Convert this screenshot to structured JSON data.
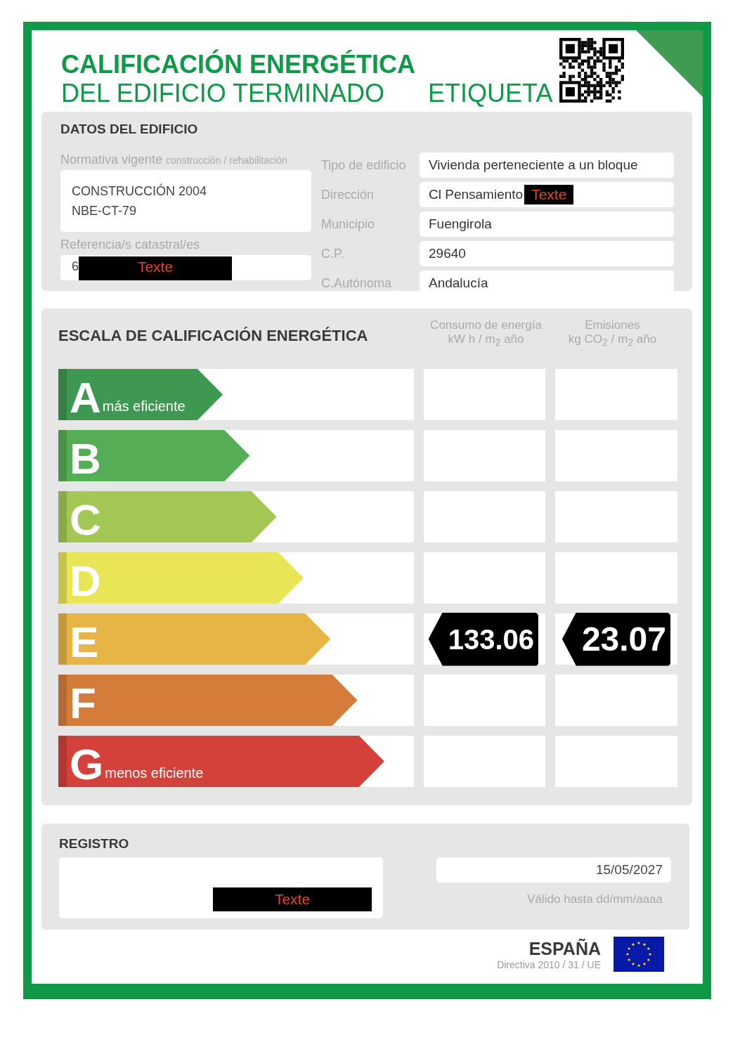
{
  "header": {
    "title_line1": "CALIFICACIÓN ENERGÉTICA",
    "title_line2": "DEL EDIFICIO TERMINADO",
    "label": "ETIQUETA"
  },
  "building": {
    "heading": "DATOS DEL EDIFICIO",
    "norm_label": "Normativa vigente",
    "norm_sublabel": "construcción / rehabilitación",
    "norm_lines": [
      "CONSTRUCCIÓN 2004",
      "NBE-CT-79"
    ],
    "ref_label": "Referencia/s catastral/es",
    "ref_value": "6",
    "ref_redaction": "Texte",
    "fields": [
      {
        "label": "Tipo de edificio",
        "value": "Vivienda perteneciente a un bloque"
      },
      {
        "label": "Dirección",
        "value": "Cl Pensamiento",
        "redaction": "Texte"
      },
      {
        "label": "Municipio",
        "value": "Fuengirola"
      },
      {
        "label": "C.P.",
        "value": "29640"
      },
      {
        "label": "C.Autónoma",
        "value": "Andalucía"
      }
    ]
  },
  "scale": {
    "heading": "ESCALA DE CALIFICACIÓN ENERGÉTICA",
    "energy_title": "Consumo de energía",
    "energy_unit": "kW h / m$_{2}$ año",
    "emissions_title": "Emisiones",
    "emissions_unit": "kg CO$_{2}$ / m$_{2}$ año",
    "classes": [
      {
        "letter": "A",
        "caption": "más eficiente",
        "color": "#3e9851"
      },
      {
        "letter": "B",
        "color": "#55ad55"
      },
      {
        "letter": "C",
        "color": "#a3c754"
      },
      {
        "letter": "D",
        "color": "#e8e556"
      },
      {
        "letter": "E",
        "color": "#e7b446",
        "energy": "133.06",
        "emissions": "23.07"
      },
      {
        "letter": "F",
        "color": "#d67c3b"
      },
      {
        "letter": "G",
        "caption": "menos eficiente",
        "color": "#d4403a"
      }
    ]
  },
  "registry": {
    "heading": "REGISTRO",
    "redaction": "Texte",
    "date": "15/05/2027",
    "date_hint": "Válido hasta dd/mm/aaaa"
  },
  "footer": {
    "country": "ESPAÑA",
    "directive": "Directiva 2010 / 31 / UE"
  }
}
